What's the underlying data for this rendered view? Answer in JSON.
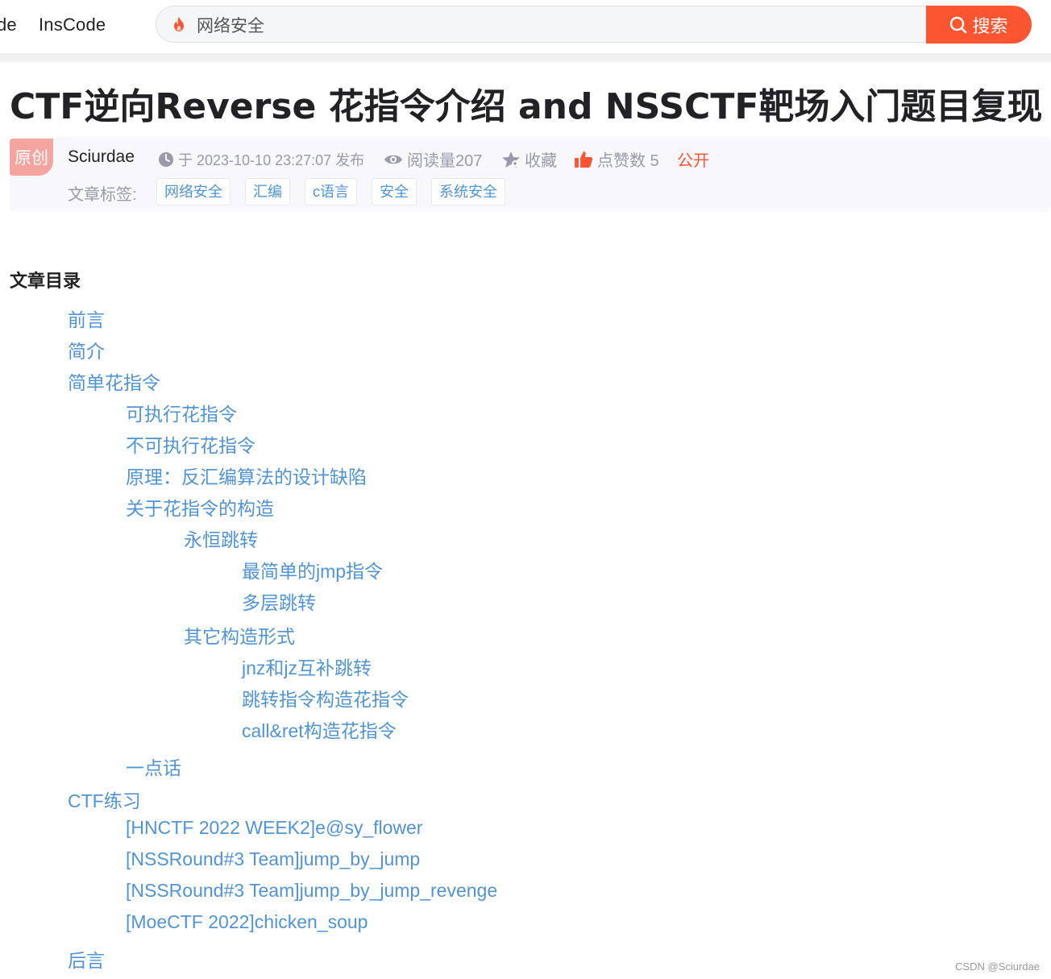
{
  "nav": {
    "partial": "de",
    "inscode": "InsCode"
  },
  "search": {
    "value": "网络安全",
    "button_label": "搜索"
  },
  "article": {
    "title": "CTF逆向Reverse 花指令介绍 and NSSCTF靶场入门题目复现",
    "badge": "原创",
    "author": "Sciurdae",
    "time": "于 2023-10-10 23:27:07 发布",
    "reads": "阅读量207",
    "favorite": "收藏",
    "likes": "点赞数 5",
    "visibility": "公开",
    "tags_label": "文章标签:",
    "tags": [
      "网络安全",
      "汇编",
      "c语言",
      "安全",
      "系统安全"
    ]
  },
  "toc": {
    "title": "文章目录",
    "items": [
      "前言",
      "简介",
      "简单花指令",
      "可执行花指令",
      "不可执行花指令",
      "原理：反汇编算法的设计缺陷",
      "关于花指令的构造",
      "永恒跳转",
      "最简单的jmp指令",
      "多层跳转",
      "其它构造形式",
      "jnz和jz互补跳转",
      "跳转指令构造花指令",
      "call&ret构造花指令",
      "一点话",
      "CTF练习",
      "[HNCTF 2022 WEEK2]e@sy_flower",
      "[NSSRound#3 Team]jump_by_jump",
      "[NSSRound#3 Team]jump_by_jump_revenge",
      "[MoeCTF 2022]chicken_soup",
      "后言"
    ]
  },
  "footer": "CSDN @Sciurdae",
  "colors": {
    "accent": "#fc5531",
    "link": "#5094d5",
    "muted": "#999aaa"
  }
}
